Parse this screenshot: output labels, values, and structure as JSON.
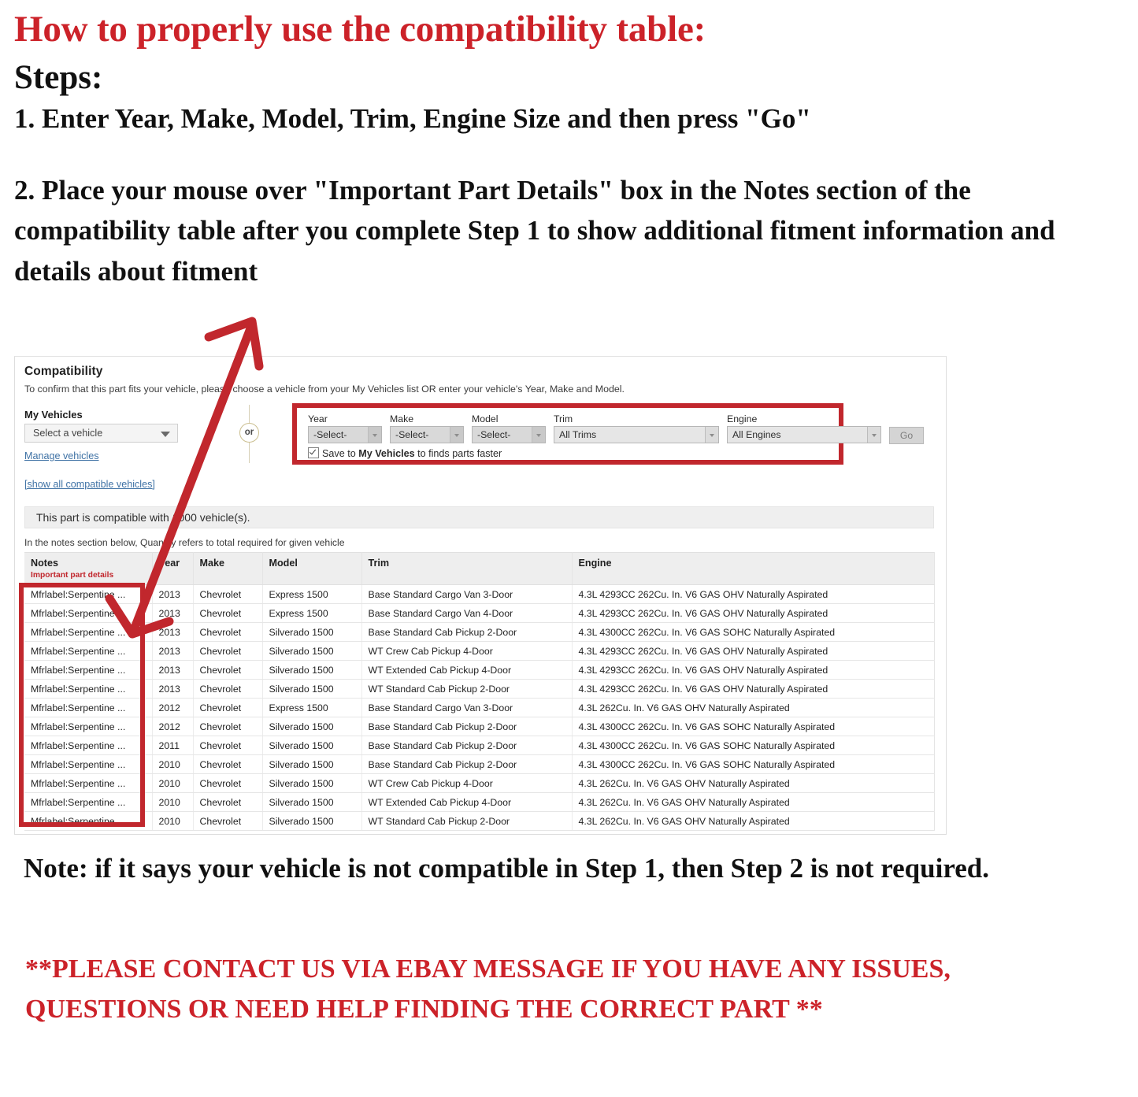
{
  "instructions": {
    "heading": "How to properly use the compatibility table:",
    "steps_label": "Steps:",
    "step1": "1. Enter Year, Make, Model, Trim, Engine Size and then press \"Go\"",
    "step2": "2. Place your mouse over \"Important Part Details\" box in the Notes section of the compatibility table after you complete Step 1 to show additional fitment information and details about fitment",
    "note": "Note: if it says your vehicle is not compatible in Step 1, then Step 2 is not required.",
    "contact": "**PLEASE CONTACT US VIA EBAY MESSAGE IF YOU HAVE ANY ISSUES, QUESTIONS OR NEED HELP FINDING THE CORRECT PART **"
  },
  "colors": {
    "accent_red": "#cc2229",
    "box_red": "#c1272d",
    "link_blue": "#3f72a5",
    "or_gold": "#cbbf90"
  },
  "compatibility": {
    "title": "Compatibility",
    "subtitle": "To confirm that this part fits your vehicle, please choose a vehicle from your My Vehicles list OR enter your vehicle's Year, Make and Model.",
    "my_vehicles": {
      "label": "My Vehicles",
      "select_value": "Select a vehicle",
      "manage_link": "Manage vehicles",
      "show_all_link": "[show all compatible vehicles]"
    },
    "or_divider": "or",
    "finder": {
      "year": {
        "label": "Year",
        "value": "-Select-"
      },
      "make": {
        "label": "Make",
        "value": "-Select-"
      },
      "model": {
        "label": "Model",
        "value": "-Select-"
      },
      "trim": {
        "label": "Trim",
        "value": "All Trims"
      },
      "engine": {
        "label": "Engine",
        "value": "All Engines"
      },
      "go_button": "Go",
      "save_prefix": "Save to ",
      "save_bold": "My Vehicles",
      "save_suffix": " to finds parts faster"
    },
    "banner": "This part is compatible with 1000 vehicle(s).",
    "notes_hint": "In the notes section below, Quantity refers to total required for given vehicle",
    "table": {
      "headers": {
        "notes": "Notes",
        "notes_sub": "Important part details",
        "year": "Year",
        "make": "Make",
        "model": "Model",
        "trim": "Trim",
        "engine": "Engine"
      },
      "rows": [
        {
          "notes": "Mfrlabel:Serpentine ...",
          "year": "2013",
          "make": "Chevrolet",
          "model": "Express 1500",
          "trim": "Base Standard Cargo Van 3-Door",
          "engine": "4.3L 4293CC 262Cu. In. V6 GAS OHV Naturally Aspirated"
        },
        {
          "notes": "Mfrlabel:Serpentine ...",
          "year": "2013",
          "make": "Chevrolet",
          "model": "Express 1500",
          "trim": "Base Standard Cargo Van 4-Door",
          "engine": "4.3L 4293CC 262Cu. In. V6 GAS OHV Naturally Aspirated"
        },
        {
          "notes": "Mfrlabel:Serpentine ...",
          "year": "2013",
          "make": "Chevrolet",
          "model": "Silverado 1500",
          "trim": "Base Standard Cab Pickup 2-Door",
          "engine": "4.3L 4300CC 262Cu. In. V6 GAS SOHC Naturally Aspirated"
        },
        {
          "notes": "Mfrlabel:Serpentine ...",
          "year": "2013",
          "make": "Chevrolet",
          "model": "Silverado 1500",
          "trim": "WT Crew Cab Pickup 4-Door",
          "engine": "4.3L 4293CC 262Cu. In. V6 GAS OHV Naturally Aspirated"
        },
        {
          "notes": "Mfrlabel:Serpentine ...",
          "year": "2013",
          "make": "Chevrolet",
          "model": "Silverado 1500",
          "trim": "WT Extended Cab Pickup 4-Door",
          "engine": "4.3L 4293CC 262Cu. In. V6 GAS OHV Naturally Aspirated"
        },
        {
          "notes": "Mfrlabel:Serpentine ...",
          "year": "2013",
          "make": "Chevrolet",
          "model": "Silverado 1500",
          "trim": "WT Standard Cab Pickup 2-Door",
          "engine": "4.3L 4293CC 262Cu. In. V6 GAS OHV Naturally Aspirated"
        },
        {
          "notes": "Mfrlabel:Serpentine ...",
          "year": "2012",
          "make": "Chevrolet",
          "model": "Express 1500",
          "trim": "Base Standard Cargo Van 3-Door",
          "engine": "4.3L 262Cu. In. V6 GAS OHV Naturally Aspirated"
        },
        {
          "notes": "Mfrlabel:Serpentine ...",
          "year": "2012",
          "make": "Chevrolet",
          "model": "Silverado 1500",
          "trim": "Base Standard Cab Pickup 2-Door",
          "engine": "4.3L 4300CC 262Cu. In. V6 GAS SOHC Naturally Aspirated"
        },
        {
          "notes": "Mfrlabel:Serpentine ...",
          "year": "2011",
          "make": "Chevrolet",
          "model": "Silverado 1500",
          "trim": "Base Standard Cab Pickup 2-Door",
          "engine": "4.3L 4300CC 262Cu. In. V6 GAS SOHC Naturally Aspirated"
        },
        {
          "notes": "Mfrlabel:Serpentine ...",
          "year": "2010",
          "make": "Chevrolet",
          "model": "Silverado 1500",
          "trim": "Base Standard Cab Pickup 2-Door",
          "engine": "4.3L 4300CC 262Cu. In. V6 GAS SOHC Naturally Aspirated"
        },
        {
          "notes": "Mfrlabel:Serpentine ...",
          "year": "2010",
          "make": "Chevrolet",
          "model": "Silverado 1500",
          "trim": "WT Crew Cab Pickup 4-Door",
          "engine": "4.3L 262Cu. In. V6 GAS OHV Naturally Aspirated"
        },
        {
          "notes": "Mfrlabel:Serpentine ...",
          "year": "2010",
          "make": "Chevrolet",
          "model": "Silverado 1500",
          "trim": "WT Extended Cab Pickup 4-Door",
          "engine": "4.3L 262Cu. In. V6 GAS OHV Naturally Aspirated"
        },
        {
          "notes": "Mfrlabel:Serpentine ...",
          "year": "2010",
          "make": "Chevrolet",
          "model": "Silverado 1500",
          "trim": "WT Standard Cab Pickup 2-Door",
          "engine": "4.3L 262Cu. In. V6 GAS OHV Naturally Aspirated"
        }
      ]
    }
  }
}
